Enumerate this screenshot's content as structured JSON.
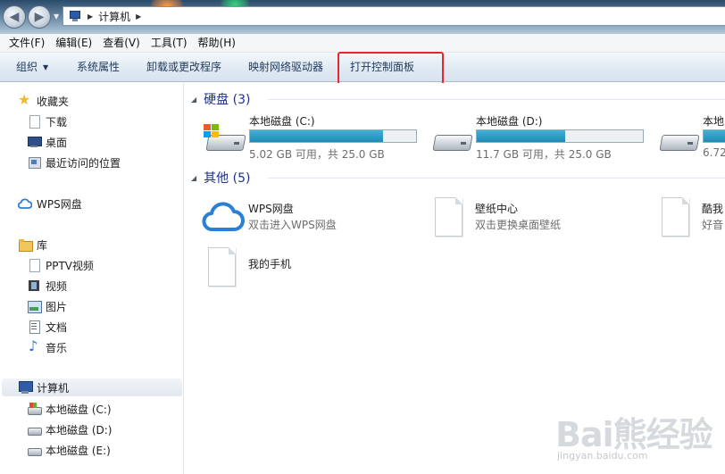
{
  "address": {
    "location": "计算机"
  },
  "menu": [
    "文件(F)",
    "编辑(E)",
    "查看(V)",
    "工具(T)",
    "帮助(H)"
  ],
  "toolbar": {
    "organize": "组织",
    "system_properties": "系统属性",
    "uninstall": "卸载或更改程序",
    "map_drive": "映射网络驱动器",
    "open_control_panel": "打开控制面板",
    "highlight_color": "#e8272c"
  },
  "sidebar": {
    "favorites": {
      "label": "收藏夹",
      "items": [
        "下载",
        "桌面",
        "最近访问的位置"
      ]
    },
    "wps": "WPS网盘",
    "libraries": {
      "label": "库",
      "items": [
        "PPTV视频",
        "视频",
        "图片",
        "文档",
        "音乐"
      ]
    },
    "computer": {
      "label": "计算机",
      "items": [
        "本地磁盘 (C:)",
        "本地磁盘 (D:)",
        "本地磁盘 (E:)"
      ]
    }
  },
  "main": {
    "drives_header": "硬盘 (3)",
    "drives": [
      {
        "name": "本地磁盘 (C:)",
        "free_text": "5.02 GB 可用，共 25.0 GB",
        "used_fraction": 0.8
      },
      {
        "name": "本地磁盘 (D:)",
        "free_text": "11.7 GB 可用，共 25.0 GB",
        "used_fraction": 0.53
      },
      {
        "name": "本地",
        "free_text": "6.72",
        "used_fraction": 0.73
      }
    ],
    "other_header": "其他 (5)",
    "others": [
      {
        "title": "WPS网盘",
        "subtitle": "双击进入WPS网盘",
        "icon": "cloud-icon"
      },
      {
        "title": "壁纸中心",
        "subtitle": "双击更换桌面壁纸",
        "icon": "file-icon"
      },
      {
        "title": "酷我",
        "subtitle": "好音",
        "icon": "file-icon"
      },
      {
        "title": "我的手机",
        "subtitle": "",
        "icon": "file-icon"
      }
    ]
  },
  "watermark": {
    "main": "Bai熊经验",
    "sub": "jingyan.baidu.com"
  }
}
